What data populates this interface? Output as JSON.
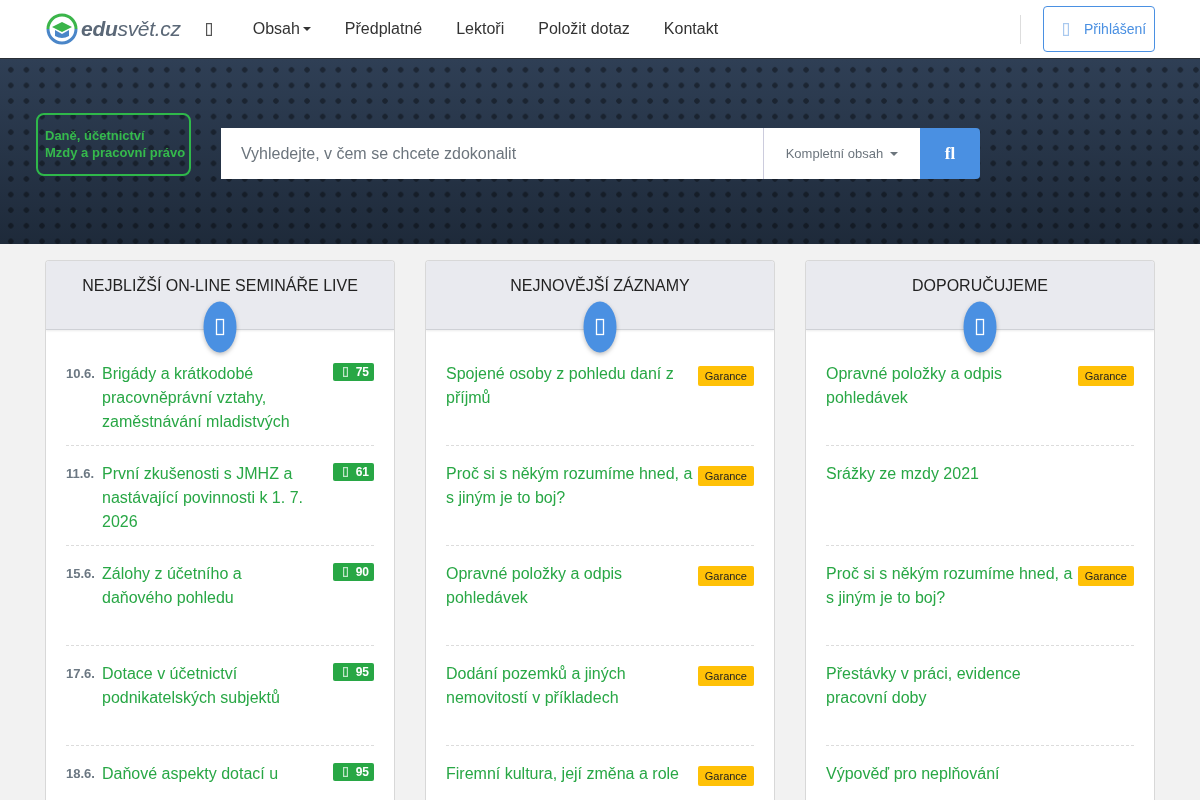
{
  "header": {
    "logo": {
      "text": "**edu**svět.cz"
    },
    "nav": [
      {
        "label": "Obsah",
        "dropdown": true
      },
      {
        "label": "Předplatné",
        "dropdown": false
      },
      {
        "label": "Lektoři",
        "dropdown": false
      },
      {
        "label": "Položit dotaz",
        "dropdown": false
      },
      {
        "label": "Kontakt",
        "dropdown": false
      }
    ],
    "login_button": {
      "label": "Přihlášení"
    }
  },
  "hero": {
    "categories": [
      "Daně, účetnictví",
      "Mzdy a pracovní právo"
    ],
    "search": {
      "placeholder": "Vyhledejte, v čem se chcete zdokonalit",
      "scope": "Kompletní obsah",
      "button": "fl"
    }
  },
  "columns": [
    {
      "title": "NEJBLIŽŠÍ ON-LINE SEMINÁŘE LIVE",
      "items": [
        {
          "date": "10.6.",
          "title": "Brigády a krátkodobé pracovněprávní vztahy, zaměstnávání mladistvých",
          "badge": {
            "kind": "count",
            "text": "75"
          }
        },
        {
          "date": "11.6.",
          "title": "První zkušenosti s JMHZ a nastávající povinnosti k 1. 7. 2026",
          "badge": {
            "kind": "count",
            "text": "61"
          }
        },
        {
          "date": "15.6.",
          "title": "Zálohy z účetního a daňového pohledu",
          "badge": {
            "kind": "count",
            "text": "90"
          }
        },
        {
          "date": "17.6.",
          "title": "Dotace v účetnictví podnikatelských subjektů",
          "badge": {
            "kind": "count",
            "text": "95"
          }
        },
        {
          "date": "18.6.",
          "title": "Daňové aspekty dotací u",
          "badge": {
            "kind": "count",
            "text": "95"
          }
        }
      ]
    },
    {
      "title": "NEJNOVĚJŠÍ ZÁZNAMY",
      "items": [
        {
          "title": "Spojené osoby z pohledu daní z příjmů",
          "badge": {
            "kind": "guarantee",
            "text": "Garance"
          }
        },
        {
          "title": "Proč si s někým rozumíme hned, a s jiným je to boj?",
          "badge": {
            "kind": "guarantee",
            "text": "Garance"
          }
        },
        {
          "title": "Opravné položky a odpis pohledávek",
          "badge": {
            "kind": "guarantee",
            "text": "Garance"
          }
        },
        {
          "title": "Dodání pozemků a jiných nemovitostí v příkladech",
          "badge": {
            "kind": "guarantee",
            "text": "Garance"
          }
        },
        {
          "title": "Firemní kultura, její změna a role",
          "badge": {
            "kind": "guarantee",
            "text": "Garance"
          }
        }
      ]
    },
    {
      "title": "DOPORUČUJEME",
      "items": [
        {
          "title": "Opravné položky a odpis pohledávek",
          "badge": {
            "kind": "guarantee",
            "text": "Garance"
          }
        },
        {
          "title": "Srážky ze mzdy 2021"
        },
        {
          "title": "Proč si s někým rozumíme hned, a s jiným je to boj?",
          "badge": {
            "kind": "guarantee",
            "text": "Garance"
          }
        },
        {
          "title": "Přestávky v práci, evidence pracovní doby"
        },
        {
          "title": "Výpověď pro neplňování"
        }
      ]
    }
  ]
}
